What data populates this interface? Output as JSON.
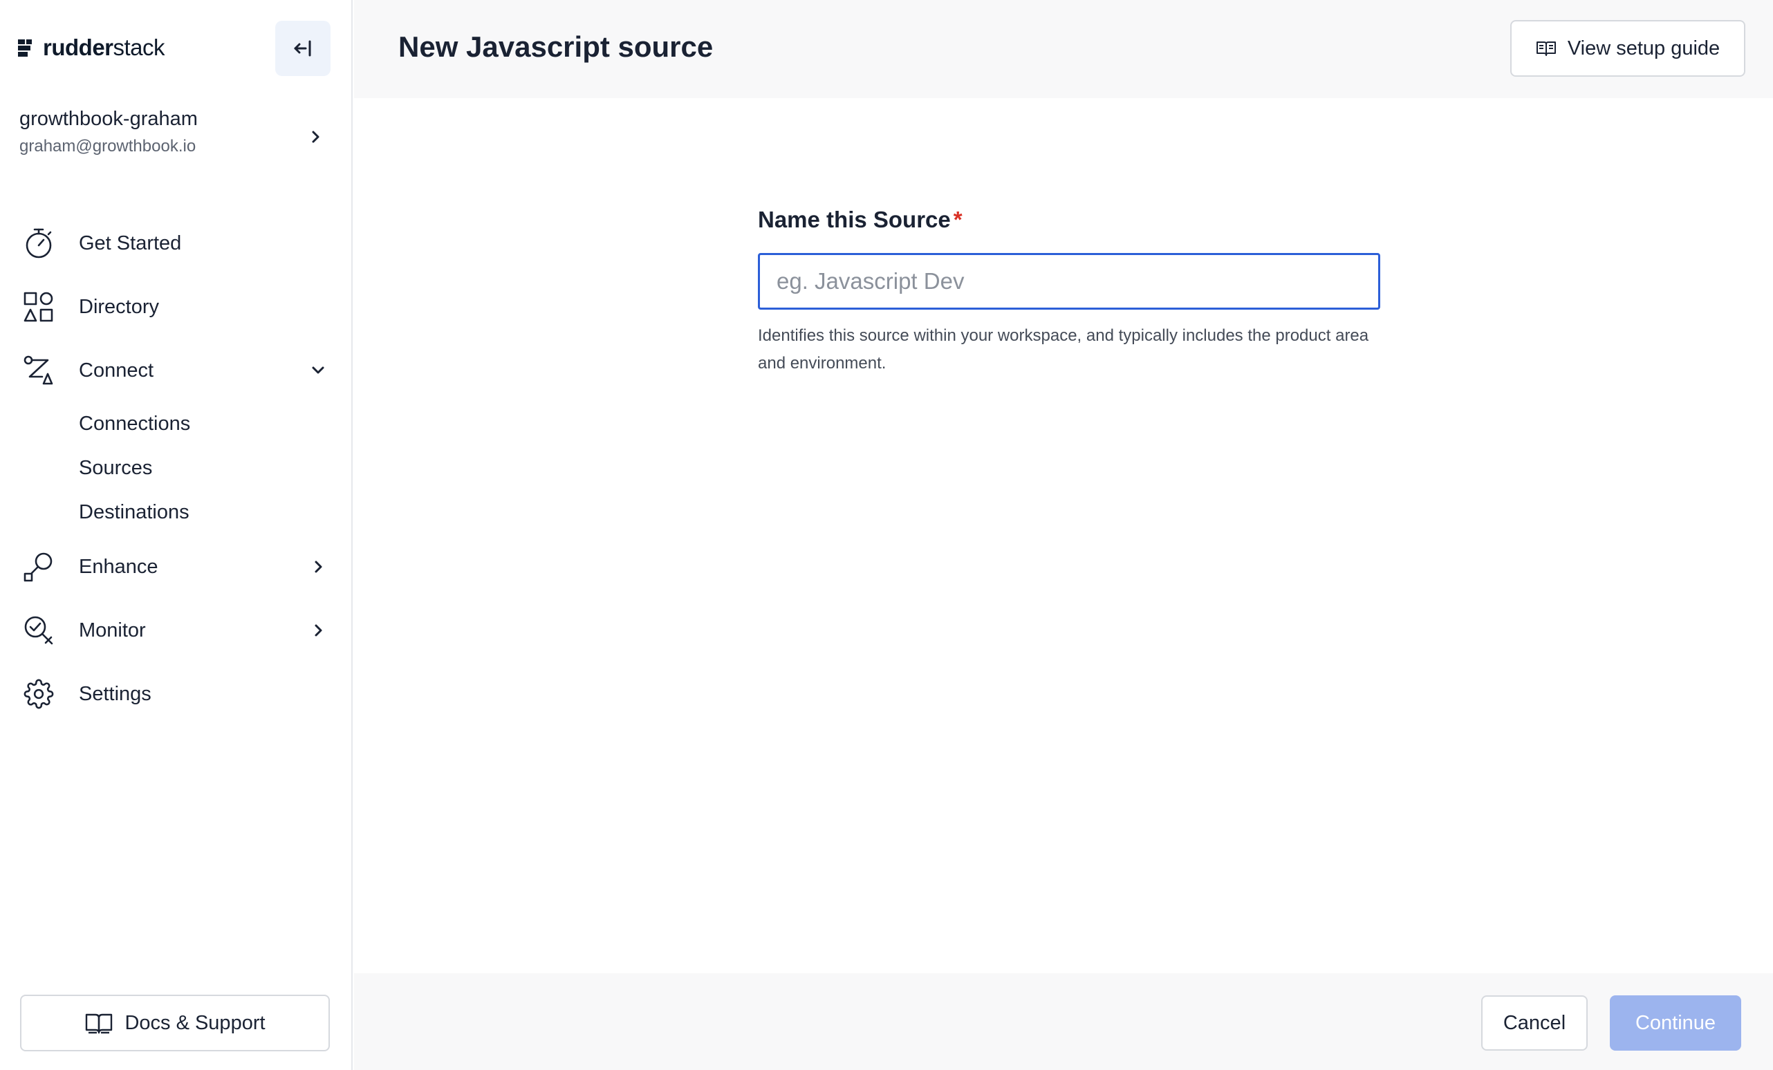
{
  "brand": {
    "name_bold": "rudder",
    "name_regular": "stack"
  },
  "workspace": {
    "name": "growthbook-graham",
    "email": "graham@growthbook.io"
  },
  "sidebar": {
    "items": [
      {
        "label": "Get Started",
        "icon": "stopwatch-icon"
      },
      {
        "label": "Directory",
        "icon": "shapes-icon"
      },
      {
        "label": "Connect",
        "icon": "connect-icon",
        "expanded": true
      },
      {
        "label": "Enhance",
        "icon": "enhance-icon"
      },
      {
        "label": "Monitor",
        "icon": "monitor-icon"
      },
      {
        "label": "Settings",
        "icon": "gear-icon"
      }
    ],
    "connect_subitems": [
      "Connections",
      "Sources",
      "Destinations"
    ],
    "docs_label": "Docs & Support"
  },
  "header": {
    "title": "New Javascript source",
    "guide_label": "View setup guide"
  },
  "form": {
    "label": "Name this Source",
    "required_mark": "*",
    "placeholder": "eg. Javascript Dev",
    "value": "",
    "help": "Identifies this source within your workspace, and typically includes the product area and environment."
  },
  "footer": {
    "cancel_label": "Cancel",
    "continue_label": "Continue"
  },
  "colors": {
    "accent": "#2c5fd8",
    "continue_disabled": "#9cb4ee",
    "required": "#d93025"
  }
}
